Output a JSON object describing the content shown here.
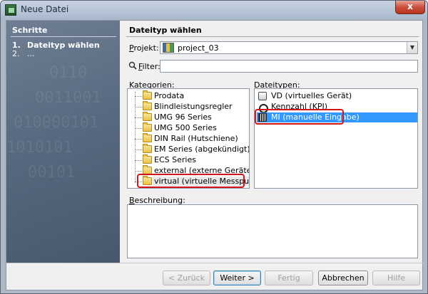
{
  "window": {
    "title": "Neue Datei",
    "close_glyph": "x"
  },
  "steps": {
    "title": "Schritte",
    "items": [
      {
        "num": "1.",
        "label": "Dateityp wählen"
      },
      {
        "num": "2.",
        "label": "..."
      }
    ]
  },
  "main": {
    "title": "Dateityp wählen",
    "project": {
      "label_underlined": "P",
      "label_rest": "rojekt:",
      "value": "project_03"
    },
    "filter": {
      "label_underlined": "F",
      "label_rest": "ilter:",
      "value": ""
    },
    "categories": {
      "label_underlined": "K",
      "label_rest": "ategorien:",
      "items": [
        "Prodata",
        "Blindleistungsregler",
        "UMG 96 Series",
        "UMG 500 Series",
        "DIN Rail (Hutschiene)",
        "EM Series (abgekündigt)",
        "ECS Series",
        "external (externe Geräte)",
        "virtual (virtuelle Messpunkte)"
      ],
      "selected_index": 8
    },
    "file_types": {
      "label_underlined": "D",
      "label_rest": "ateitypen:",
      "items": [
        {
          "icon": "virtual-device-icon",
          "label": "VD (virtuelles Gerät)"
        },
        {
          "icon": "kpi-icon",
          "label": "Kennzahl (KPI)"
        },
        {
          "icon": "manual-input-icon",
          "label": "MI (manuelle Eingabe)"
        }
      ],
      "selected_index": 2
    },
    "description": {
      "label_underlined": "B",
      "label_rest": "eschreibung:",
      "value": ""
    }
  },
  "buttons": {
    "back": "< Zurück",
    "next": "Weiter >",
    "finish": "Fertig",
    "cancel": "Abbrechen",
    "help": "Hilfe"
  },
  "colors": {
    "highlight_box": "#d4141c",
    "selection": "#3399ff"
  }
}
